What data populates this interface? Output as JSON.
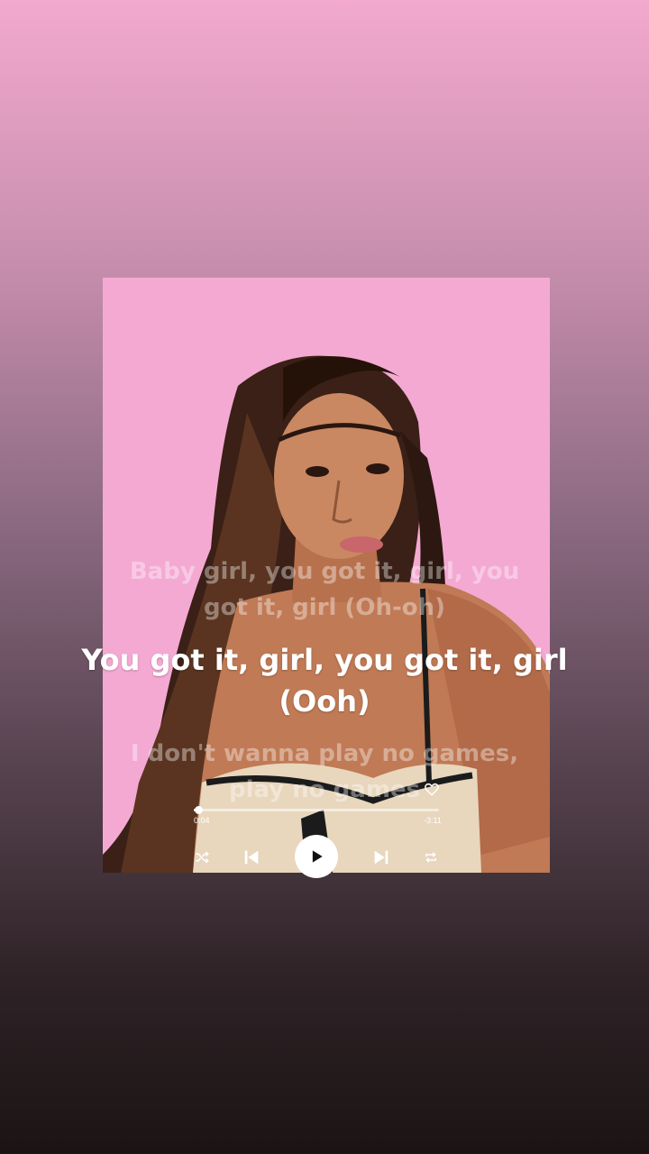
{
  "lyrics": {
    "previous": [
      "Baby girl, you got it, girl, you",
      "got it, girl (Oh-oh)"
    ],
    "current": [
      "You got it, girl, you got it, girl",
      "(Ooh)"
    ],
    "next": [
      "I don't wanna play no games,",
      "play no games"
    ]
  },
  "player": {
    "elapsed": "0:04",
    "remaining": "-3:11",
    "progress": 0.02,
    "liked": false
  },
  "controls": [
    "shuffle-icon",
    "previous-icon",
    "play-icon",
    "next-icon",
    "repeat-icon"
  ],
  "colors": {
    "card_background": "#f4a9d3",
    "accent": "#ffffff"
  }
}
